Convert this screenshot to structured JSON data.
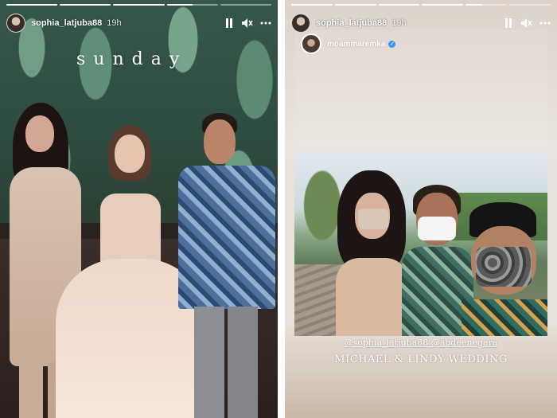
{
  "left_story": {
    "progress": [
      {
        "fill": 1.0
      },
      {
        "fill": 1.0
      },
      {
        "fill": 1.0
      },
      {
        "fill": 0.5
      },
      {
        "fill": 0
      }
    ],
    "username": "sophia_latjuba88",
    "timestamp": "19h",
    "sticker_text": "sunday"
  },
  "right_story": {
    "progress": [
      {
        "fill": 1.0
      },
      {
        "fill": 1.0
      },
      {
        "fill": 1.0
      },
      {
        "fill": 1.0
      },
      {
        "fill": 0.4
      },
      {
        "fill": 0
      }
    ],
    "username": "sophia_latjuba88",
    "timestamp": "19h",
    "repost_username": "moammaremka",
    "caption_tags": "@sophia_latjuba88 @abdeenegara",
    "caption_title": "MICHAEL & LINDY WEDDING"
  },
  "icons": {
    "pause": "pause-icon",
    "mute": "mute-icon",
    "more": "more-icon",
    "verified": "verified-icon"
  },
  "colors": {
    "verified_badge": "#3897f0"
  }
}
